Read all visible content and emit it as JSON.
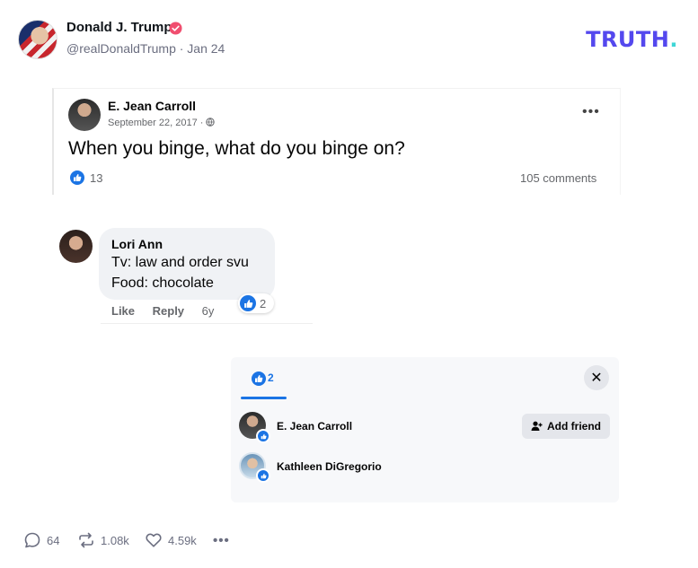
{
  "post": {
    "author_name": "Donald J. Trump",
    "handle_date": "@realDonaldTrump · Jan 24",
    "brand": "TRUTH",
    "brand_dot": "."
  },
  "fb_post": {
    "author": "E. Jean Carroll",
    "date": "September 22, 2017 · ",
    "menu": "•••",
    "text": "When you binge, what do you binge on?",
    "like_count": "13",
    "comments": "105 comments"
  },
  "comment": {
    "author": "Lori Ann",
    "line1": "Tv: law and order svu",
    "line2": "Food: chocolate",
    "reaction_count": "2",
    "actions": [
      "Like",
      "Reply"
    ],
    "age": "6y"
  },
  "reactions_popup": {
    "tab_count": "2",
    "close": "✕",
    "people": [
      {
        "name": "E. Jean Carroll"
      },
      {
        "name": "Kathleen DiGregorio"
      }
    ],
    "add_friend_label": "Add friend"
  },
  "action_bar": {
    "replies": "64",
    "retruths": "1.08k",
    "likes": "4.59k",
    "more": "•••"
  },
  "colors": {
    "brand": "#5448ee",
    "facebook_blue": "#1b74e4",
    "verified": "#f04e6f"
  }
}
